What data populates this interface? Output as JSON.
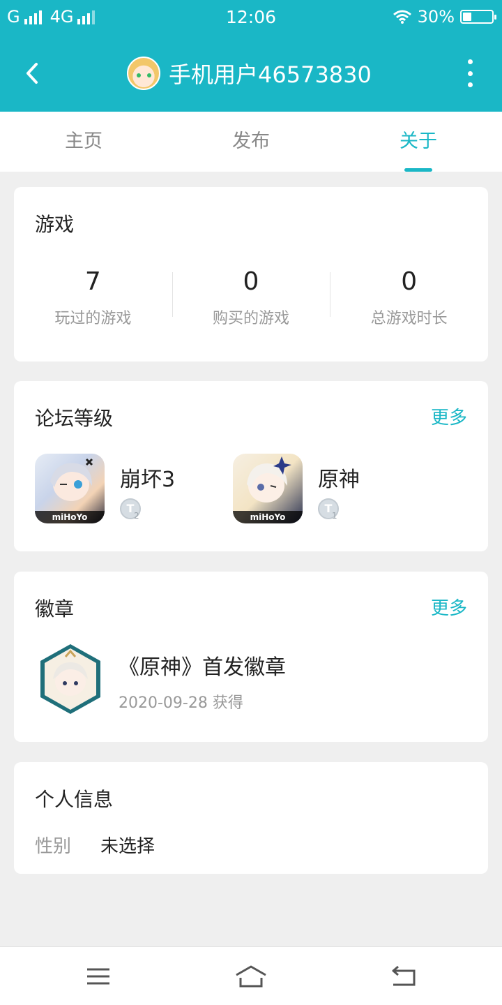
{
  "status_bar": {
    "carrier1": "G",
    "carrier2": "4G",
    "time": "12:06",
    "battery": "30%",
    "battery_level": 0.3,
    "icons": [
      "signal-icon",
      "wifi-icon",
      "battery-icon"
    ]
  },
  "header": {
    "title": "手机用户46573830",
    "back_icon": "back-arrow-icon",
    "more_icon": "more-vertical-icon",
    "accent_color": "#1ab7c6"
  },
  "tabs": [
    {
      "label": "主页",
      "active": false
    },
    {
      "label": "发布",
      "active": false
    },
    {
      "label": "关于",
      "active": true
    }
  ],
  "games_card": {
    "title": "游戏",
    "stats": [
      {
        "value": "7",
        "label": "玩过的游戏"
      },
      {
        "value": "0",
        "label": "购买的游戏"
      },
      {
        "value": "0",
        "label": "总游戏时长"
      }
    ]
  },
  "forum_card": {
    "title": "论坛等级",
    "more": "更多",
    "games": [
      {
        "name": "崩坏3",
        "level_letter": "T",
        "level_num": "2",
        "icon_logo": "miHoYo"
      },
      {
        "name": "原神",
        "level_letter": "T",
        "level_num": "1",
        "icon_logo": "miHoYo"
      }
    ]
  },
  "badge_card": {
    "title": "徽章",
    "more": "更多",
    "badge_name": "《原神》首发徽章",
    "badge_date": "2020-09-28 获得"
  },
  "info_card": {
    "title": "个人信息",
    "gender_label": "性别",
    "gender_value": "未选择"
  },
  "nav_bar": {
    "icons": [
      "menu-icon",
      "home-icon",
      "back-icon"
    ]
  }
}
